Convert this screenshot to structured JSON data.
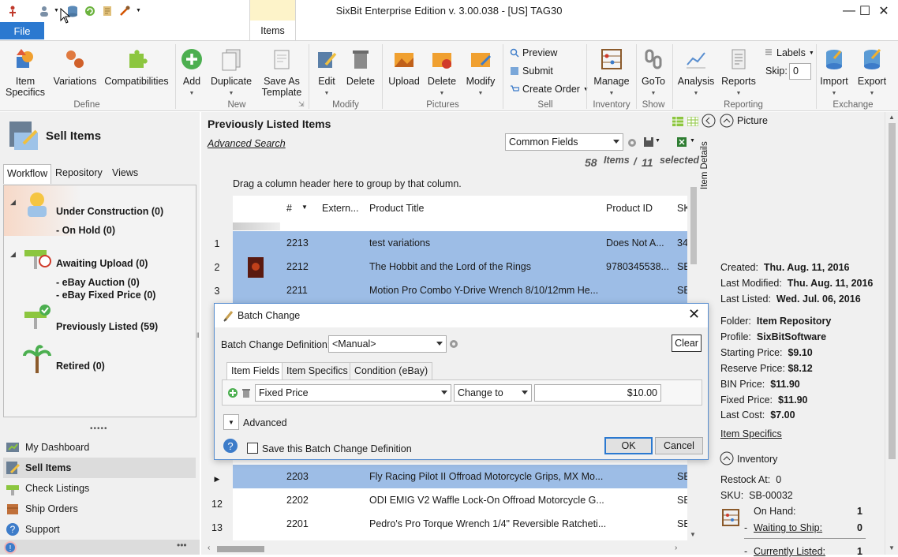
{
  "window": {
    "title": "SixBit Enterprise Edition v. 3.00.038 - [US] TAG30"
  },
  "ribbon": {
    "file_tab": "File",
    "items_tab": "Items",
    "buttons": {
      "item_specifics": [
        "Item",
        "Specifics"
      ],
      "variations": "Variations",
      "compatibilities": "Compatibilities",
      "add": "Add",
      "duplicate": "Duplicate",
      "save_as_template": [
        "Save As",
        "Template"
      ],
      "edit": "Edit",
      "delete": "Delete",
      "upload": "Upload",
      "pic_delete": "Delete",
      "modify": "Modify",
      "preview": "Preview",
      "submit": "Submit",
      "create_order": "Create Order",
      "manage": "Manage",
      "goto": "GoTo",
      "analysis": "Analysis",
      "reports": "Reports",
      "labels": "Labels",
      "skip": "Skip:",
      "skip_value": "0",
      "import": "Import",
      "export": "Export"
    },
    "groups": {
      "define": "Define",
      "new": "New",
      "modify": "Modify",
      "pictures": "Pictures",
      "sell": "Sell",
      "inventory": "Inventory",
      "show": "Show",
      "reporting": "Reporting",
      "exchange": "Exchange"
    }
  },
  "left": {
    "title": "Sell Items",
    "tabs": [
      "Workflow",
      "Repository",
      "Views"
    ],
    "workflow": {
      "under_construction": "Under Construction  (0)",
      "on_hold": "- On Hold  (0)",
      "awaiting_upload": "Awaiting Upload  (0)",
      "ebay_auction": "- eBay Auction  (0)",
      "ebay_fixed": "- eBay Fixed Price  (0)",
      "previously_listed": "Previously Listed  (59)",
      "retired": "Retired  (0)"
    },
    "nav": [
      "My Dashboard",
      "Sell Items",
      "Check Listings",
      "Ship Orders",
      "Support"
    ]
  },
  "center": {
    "heading": "Previously Listed Items",
    "advanced_search": "Advanced Search",
    "fields_combo": "Common Fields",
    "items_count": "58",
    "items_label": "Items",
    "slash": "/",
    "selected_count": "11",
    "selected_label": "selected",
    "group_hint": "Drag a column header here to group by that column.",
    "columns": [
      "#",
      "Extern...",
      "Product Title",
      "Product ID",
      "SK"
    ],
    "rows_top": [
      {
        "row": "1",
        "num": "2213",
        "title": "test variations",
        "pid": "Does Not A...",
        "sku": "34"
      },
      {
        "row": "2",
        "num": "2212",
        "title": "The Hobbit and the Lord of the Rings",
        "pid": "9780345538...",
        "sku": "SB"
      },
      {
        "row": "3",
        "num": "2211",
        "title": "Motion Pro Combo Y-Drive Wrench 8/10/12mm He...",
        "pid": "",
        "sku": "SB"
      }
    ],
    "rows_bottom": [
      {
        "row": "",
        "num": "2203",
        "title": "Fly Racing Pilot II Offroad Motorcycle Grips, MX Mo...",
        "pid": "",
        "sku": "SB"
      },
      {
        "row": "12",
        "num": "2202",
        "title": "ODI EMIG V2 Waffle Lock-On Offroad Motorcycle G...",
        "pid": "",
        "sku": "SB"
      },
      {
        "row": "13",
        "num": "2201",
        "title": "Pedro's Pro Torque Wrench 1/4\" Reversible Ratcheti...",
        "pid": "",
        "sku": "SB"
      }
    ]
  },
  "right": {
    "item_details_vertical": "Item Details",
    "picture": "Picture",
    "created_label": "Created:",
    "created": "Thu. Aug. 11, 2016",
    "modified_label": "Last Modified:",
    "modified": "Thu. Aug. 11, 2016",
    "listed_label": "Last Listed:",
    "listed": "Wed. Jul. 06, 2016",
    "folder_label": "Folder:",
    "folder": "Item Repository",
    "profile_label": "Profile:",
    "profile": "SixBitSoftware",
    "start_label": "Starting Price:",
    "start": "$9.10",
    "reserve_label": "Reserve Price:",
    "reserve": "$8.12",
    "bin_label": "BIN Price:",
    "bin": "$11.90",
    "fixed_label": "Fixed Price:",
    "fixed": "$11.90",
    "cost_label": "Last Cost:",
    "cost": "$7.00",
    "item_specifics_link": "Item Specifics",
    "inventory": "Inventory",
    "restock_label": "Restock At:",
    "restock": "0",
    "sku_label": "SKU:",
    "sku": "SB-00032",
    "onhand_label": "On Hand:",
    "onhand": "1",
    "waiting_label": "Waiting to Ship:",
    "waiting": "0",
    "currently_label": "Currently Listed:",
    "currently": "1"
  },
  "dialog": {
    "title": "Batch Change",
    "definition_label": "Batch Change Definition:",
    "definition_value": "<Manual>",
    "clear": "Clear",
    "tabs": [
      "Item Fields",
      "Item Specifics",
      "Condition (eBay)"
    ],
    "field": "Fixed Price",
    "operation": "Change to",
    "value": "$10.00",
    "advanced": "Advanced",
    "save_definition": "Save this Batch Change Definition",
    "ok": "OK",
    "cancel": "Cancel"
  }
}
